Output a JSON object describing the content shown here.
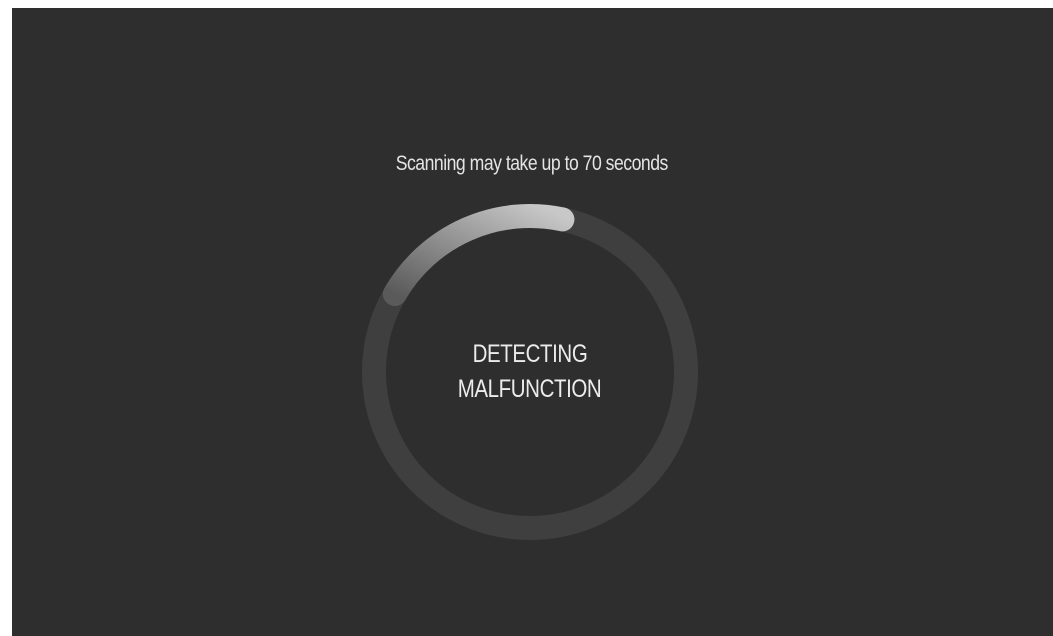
{
  "scan_note": "Scanning may take up to 70 seconds",
  "status": {
    "line1": "DETECTING",
    "line2": "MALFUNCTION"
  },
  "progress": {
    "fraction": 0.2,
    "track_color": "#3f3f3f",
    "arc_start_color": "#5a5a5a",
    "arc_end_color": "#c8c8c8"
  },
  "colors": {
    "background": "#2e2e2e",
    "text": "#e8e8e8"
  }
}
